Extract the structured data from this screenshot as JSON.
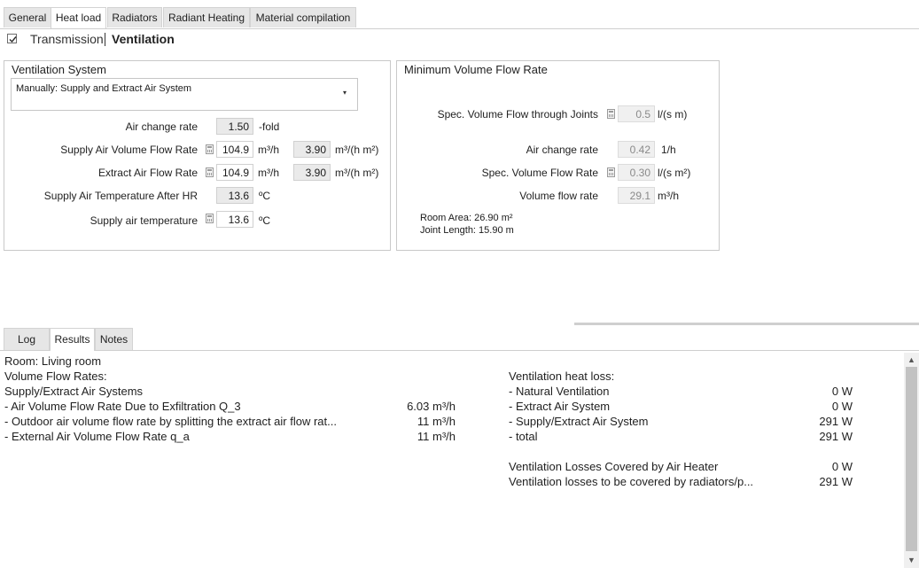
{
  "top_tabs": [
    "General",
    "Heat load",
    "Radiators",
    "Radiant Heating",
    "Material compilation"
  ],
  "active_top_tab": "Heat load",
  "mode": {
    "checkbox_checked": true,
    "transmission_label": "Transmission",
    "ventilation_label": "Ventilation"
  },
  "ventilation_system": {
    "title": "Ventilation System",
    "dropdown_value": "Manually: Supply and Extract Air System",
    "rows": {
      "air_change": {
        "label": "Air change rate",
        "value": "1.50",
        "unit": "-fold"
      },
      "supply_flow": {
        "label": "Supply Air Volume Flow Rate",
        "value": "104.9",
        "unit": "m³/h",
        "value2": "3.90",
        "unit2": "m³/(h m²)"
      },
      "extract_flow": {
        "label": "Extract Air Flow Rate",
        "value": "104.9",
        "unit": "m³/h",
        "value2": "3.90",
        "unit2": "m³/(h m²)"
      },
      "supply_temp_hr": {
        "label": "Supply Air Temperature After HR",
        "value": "13.6",
        "unit": "ºC"
      },
      "supply_temp": {
        "label": "Supply air temperature",
        "value": "13.6",
        "unit": "ºC"
      }
    }
  },
  "min_volume_flow": {
    "title": "Minimum Volume Flow Rate",
    "rows": {
      "spec_joints": {
        "label": "Spec. Volume Flow through Joints",
        "value": "0.5",
        "unit": "l/(s m)"
      },
      "air_change": {
        "label": "Air change rate",
        "value": "0.42",
        "unit": "1/h"
      },
      "spec_flow": {
        "label": "Spec. Volume Flow Rate",
        "value": "0.30",
        "unit": "l/(s m²)"
      },
      "volume_flow": {
        "label": "Volume flow rate",
        "value": "29.1",
        "unit": "m³/h"
      }
    },
    "room_area": "Room Area: 26.90 m²",
    "joint_length": "Joint Length: 15.90 m"
  },
  "bottom_tabs": [
    "Log",
    "Results",
    "Notes"
  ],
  "active_bottom_tab": "Results",
  "results": {
    "room": "Room: Living room",
    "heading_flow": "Volume Flow Rates:",
    "subheading": "Supply/Extract Air Systems",
    "flow_rows": [
      {
        "label": "- Air Volume Flow Rate Due to Exfiltration Q_3",
        "value": "6.03 m³/h"
      },
      {
        "label": "- Outdoor air volume flow rate by splitting the extract air flow rat...",
        "value": "11 m³/h"
      },
      {
        "label": "- External Air Volume Flow Rate q_a",
        "value": "11 m³/h"
      }
    ],
    "heading_loss": "Ventilation heat loss:",
    "loss_rows": [
      {
        "label": "- Natural Ventilation",
        "value": "0 W"
      },
      {
        "label": "- Extract Air System",
        "value": "0 W"
      },
      {
        "label": "- Supply/Extract Air System",
        "value": "291 W"
      },
      {
        "label": "- total",
        "value": "291 W"
      }
    ],
    "cover_rows": [
      {
        "label": "Ventilation Losses Covered by Air Heater",
        "value": "0 W"
      },
      {
        "label": "Ventilation losses to be covered by radiators/p...",
        "value": "291 W"
      }
    ]
  }
}
